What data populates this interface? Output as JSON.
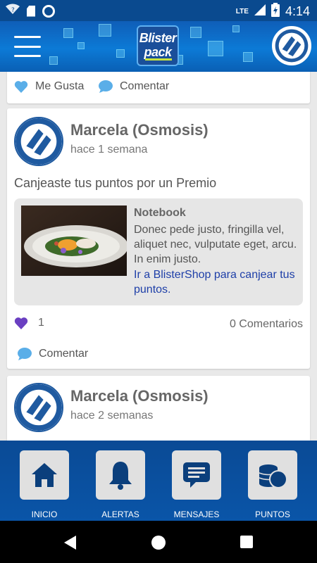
{
  "status_bar": {
    "network": "LTE",
    "time": "4:14",
    "colors": {
      "bar": "#0a4a8f",
      "icon": "#ffffff"
    }
  },
  "header": {
    "logo_line1": "Blister",
    "logo_line2": "pack",
    "colors": {
      "primary": "#0c7ad6",
      "logo_accent": "#c8e33d"
    }
  },
  "feed": {
    "previous_post": {
      "like_label": "Me Gusta",
      "comment_label": "Comentar"
    },
    "post_1": {
      "author": "Marcela (Osmosis)",
      "time": "hace 1 semana",
      "text": "Canjeaste tus puntos por un Premio",
      "prize": {
        "title": "Notebook",
        "description": "Donec pede justo, fringilla vel, aliquet nec, vulputate eget, arcu. In enim justo.",
        "link": "Ir a BlisterShop para canjear tus puntos."
      },
      "like_count": "1",
      "comments_count": "0 Comentarios",
      "comment_label": "Comentar"
    },
    "post_2": {
      "author": "Marcela (Osmosis)",
      "time": "hace 2 semanas"
    }
  },
  "bottom_nav": {
    "items": [
      {
        "label": "INICIO",
        "icon": "home-icon"
      },
      {
        "label": "ALERTAS",
        "icon": "bell-icon"
      },
      {
        "label": "MENSAJES",
        "icon": "message-icon"
      },
      {
        "label": "PUNTOS",
        "icon": "coins-icon"
      }
    ]
  },
  "colors": {
    "like_heart_active": "#6a3fc1",
    "like_heart_inactive": "#5aaee8",
    "link": "#1e3fa8",
    "nav_bg": "#0a4a95"
  }
}
